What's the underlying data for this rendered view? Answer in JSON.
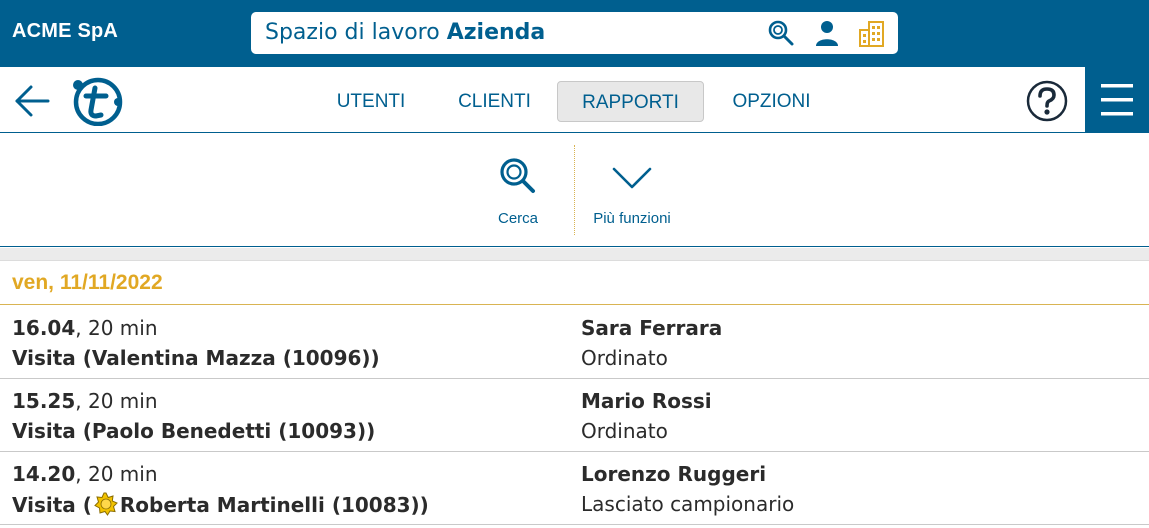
{
  "header": {
    "company": "ACME SpA",
    "workspace_prefix": "Spazio di lavoro",
    "workspace_name": "Azienda"
  },
  "nav": {
    "tabs": [
      {
        "label": "UTENTI",
        "active": false
      },
      {
        "label": "CLIENTI",
        "active": false
      },
      {
        "label": "RAPPORTI",
        "active": true
      },
      {
        "label": "OPZIONI",
        "active": false
      }
    ]
  },
  "toolbar": {
    "search_label": "Cerca",
    "more_label": "Più funzioni"
  },
  "list": {
    "date": "ven, 11/11/2022",
    "rows": [
      {
        "time": "16.04",
        "duration": ", 20 min",
        "title_prefix": "Visita (",
        "title_name": "Valentina Mazza (10096))",
        "has_badge": false,
        "person": "Sara Ferrara",
        "status": "Ordinato"
      },
      {
        "time": "15.25",
        "duration": ", 20 min",
        "title_prefix": "Visita (",
        "title_name": "Paolo Benedetti (10093))",
        "has_badge": false,
        "person": "Mario Rossi",
        "status": "Ordinato"
      },
      {
        "time": "14.20",
        "duration": ", 20 min",
        "title_prefix": "Visita (",
        "title_name": "Roberta Martinelli (10083))",
        "has_badge": true,
        "person": "Lorenzo Ruggeri",
        "status": "Lasciato campionario"
      }
    ]
  },
  "colors": {
    "brand": "#005f8f",
    "accent": "#e1a824",
    "active_tab_bg": "#e8e8e8"
  },
  "icons": [
    "search-icon",
    "user-icon",
    "buildings-icon",
    "back-arrow-icon",
    "logo",
    "help-icon",
    "hamburger-menu-icon",
    "chevron-down-icon",
    "badge-star-icon"
  ]
}
